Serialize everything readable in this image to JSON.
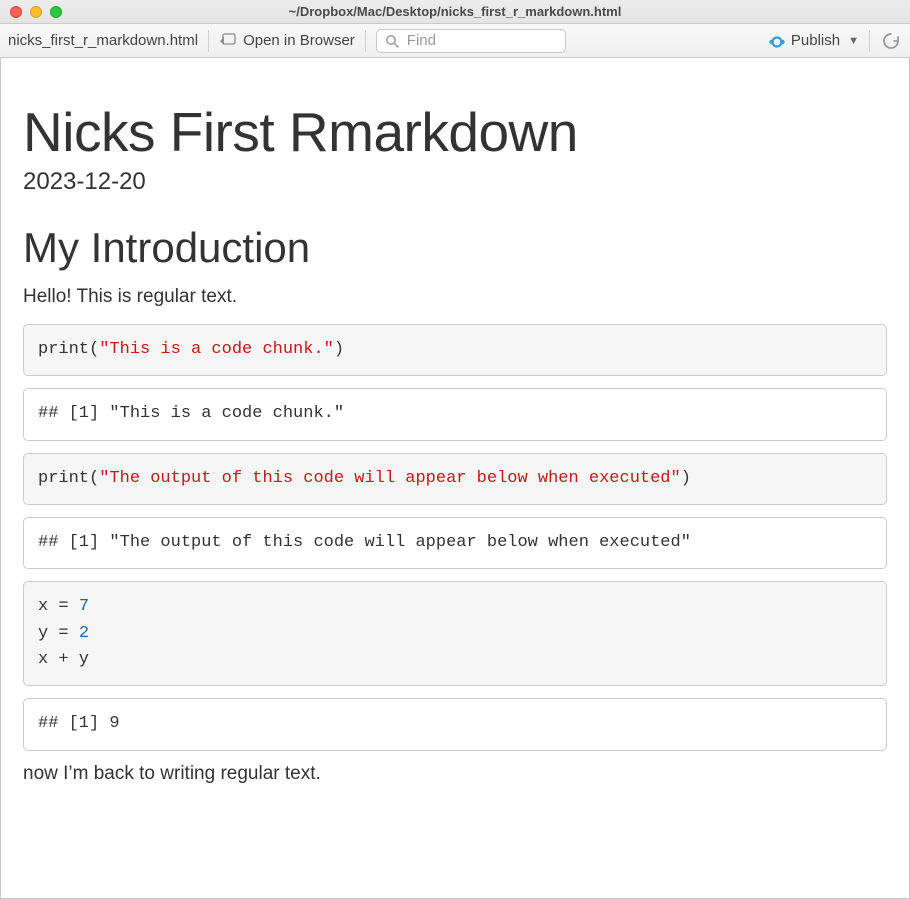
{
  "window": {
    "title_path": "~/Dropbox/Mac/Desktop/nicks_first_r_markdown.html",
    "filename": "nicks_first_r_markdown.html"
  },
  "toolbar": {
    "open_in_browser_label": "Open in Browser",
    "find_placeholder": "Find",
    "publish_label": "Publish"
  },
  "doc": {
    "title": "Nicks First Rmarkdown",
    "date": "2023-12-20",
    "section_heading": "My Introduction",
    "intro_text": "Hello! This is regular text.",
    "outro_text": "now I’m back to writing regular text."
  },
  "chunks": [
    {
      "code_prefix": "print(",
      "code_string": "\"This is a code chunk.\"",
      "code_suffix": ")",
      "output": "## [1] \"This is a code chunk.\""
    },
    {
      "code_prefix": "print(",
      "code_string": "\"The output of this code will appear below when executed\"",
      "code_suffix": ")",
      "output": "## [1] \"The output of this code will appear below when executed\""
    },
    {
      "line1_lhs": "x = ",
      "line1_num": "7",
      "line2_lhs": "y = ",
      "line2_num": "2",
      "line3": "x + y",
      "output": "## [1] 9"
    }
  ]
}
